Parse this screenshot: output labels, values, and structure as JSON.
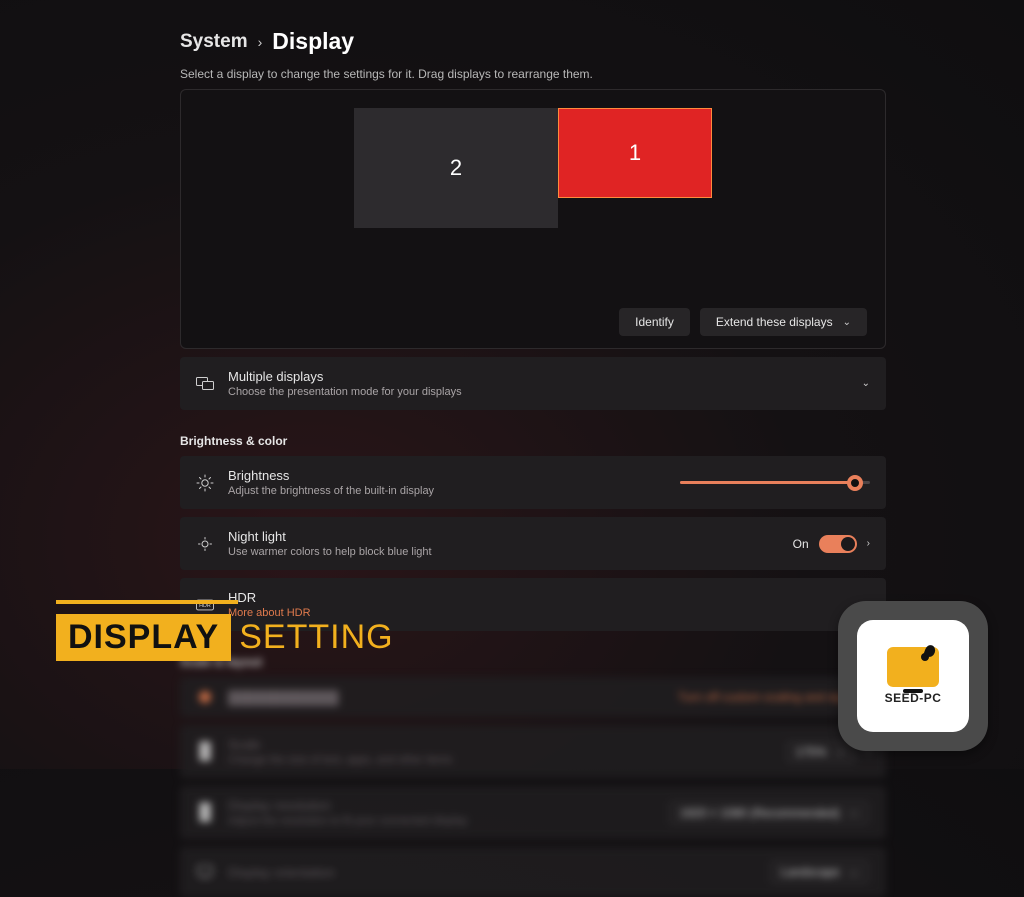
{
  "breadcrumb": {
    "parent": "System",
    "current": "Display"
  },
  "helper": "Select a display to change the settings for it. Drag displays to rearrange them.",
  "monitors": {
    "primary": "1",
    "secondary": "2"
  },
  "arrange": {
    "identify": "Identify",
    "mode": "Extend these displays"
  },
  "multiple": {
    "title": "Multiple displays",
    "sub": "Choose the presentation mode for your displays"
  },
  "sections": {
    "brightness_color": "Brightness & color",
    "scale_layout": "Scale & layout"
  },
  "brightness": {
    "title": "Brightness",
    "sub": "Adjust the brightness of the built-in display",
    "value_pct": 92
  },
  "night_light": {
    "title": "Night light",
    "sub": "Use warmer colors to help block blue light",
    "state": "On"
  },
  "hdr": {
    "title": "HDR",
    "sub": "More about HDR"
  },
  "custom_scale_warning": "Turn off custom scaling and sign out",
  "scale": {
    "title": "Scale",
    "sub": "Change the size of text, apps, and other items",
    "value": "175%"
  },
  "resolution": {
    "title": "Display resolution",
    "sub": "Adjust the resolution to fit your connected display",
    "value": "1920 × 1080 (Recommended)"
  },
  "orientation": {
    "title": "Display orientation",
    "value": "Landscape"
  },
  "overlay": {
    "box": "DISPLAY",
    "rest": "SETTING"
  },
  "watermark": {
    "label": "SEED-PC"
  },
  "colors": {
    "accent": "#e9805b",
    "monitor_selected": "#e02424",
    "brand_yellow": "#f2b01e"
  }
}
